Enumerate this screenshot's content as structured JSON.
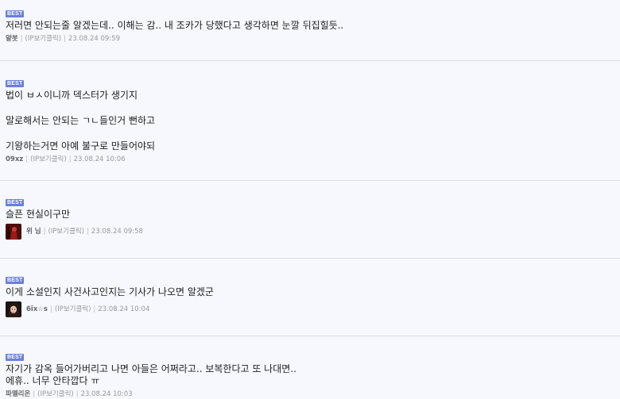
{
  "badge_label": "BEST",
  "ip_link_text": "(IP보기클릭)",
  "separator": "|",
  "comments": [
    {
      "lines": [
        "저러면 안되는줄 알겠는데.. 이해는 감.. 내 조카가 당했다고 생각하면 눈깔 뒤집힐듯.."
      ],
      "author": "얄봇",
      "timestamp": "23.08.24 09:59",
      "has_avatar": false
    },
    {
      "lines": [
        "법이 ㅂㅅ이니까 덱스터가 생기지",
        "말로해서는 안되는 ㄱㄴ들인거 뻔하고",
        "기왕하는거면 아예 불구로 만들어야되"
      ],
      "author": "09xz",
      "timestamp": "23.08.24 10:06",
      "has_avatar": false
    },
    {
      "lines": [
        "슬픈 현실이구만"
      ],
      "author": "위 님",
      "timestamp": "23.08.24 09:58",
      "has_avatar": true
    },
    {
      "lines": [
        "이게 소설인지 사건사고인지는 기사가 나오면 알겠군"
      ],
      "author": "6ix☆s",
      "timestamp": "23.08.24 10:04",
      "has_avatar": true
    },
    {
      "lines": [
        "자기가 감옥 들어가버리고 나면 아들은 어쩌라고.. 보복한다고 또 나대면..",
        "에휴.. 너무 안타깝다 ㅠ"
      ],
      "author": "파멜리온",
      "timestamp": "23.08.24 10:03",
      "has_avatar": false
    }
  ],
  "colors": {
    "background": "#f6f8fd",
    "badge": "#6b7fd7",
    "divider": "#d9dce3",
    "meta_text": "#999999",
    "author_text": "#666666"
  }
}
